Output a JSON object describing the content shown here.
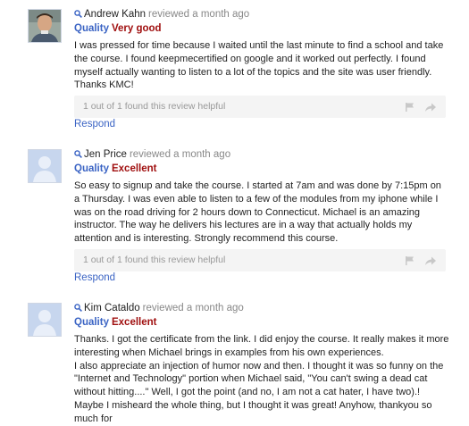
{
  "reviews": [
    {
      "author": "Andrew Kahn",
      "meta": "reviewed a month ago",
      "quality_label": "Quality",
      "rating": "Very good",
      "avatar": "user-photo",
      "body": "I was pressed for time because I waited until the last minute to find a school and take the course. I found keepmecertified on google and it worked out perfectly. I found myself actually wanting to listen to a lot of the topics and the site was user friendly. Thanks KMC!",
      "helpful": "1 out of 1 found this review helpful",
      "respond": "Respond"
    },
    {
      "author": "Jen Price",
      "meta": "reviewed a month ago",
      "quality_label": "Quality",
      "rating": "Excellent",
      "avatar": "default-user-silhouette",
      "body": "So easy to signup and take the course. I started at 7am and was done by 7:15pm on a Thursday. I was even able to listen to a few of the modules from my iphone while I was on the road driving for 2 hours down to Connecticut. Michael is an amazing instructor. The way he delivers his lectures are in a way that actually holds my attention and is interesting. Strongly recommend this course.",
      "helpful": "1 out of 1 found this review helpful",
      "respond": "Respond"
    },
    {
      "author": "Kim Cataldo",
      "meta": "reviewed a month ago",
      "quality_label": "Quality",
      "rating": "Excellent",
      "avatar": "default-user-silhouette",
      "body_paragraphs": [
        "Thanks. I got the certificate from the link. I did enjoy the course. It really makes it more interesting when Michael brings in examples from his own experiences.",
        "I also appreciate an injection of humor now and then. I thought it was so funny on the \"Internet and Technology\" portion when Michael said, \"You can't swing a dead cat without hitting....\" Well, I got the point (and no, I am not a cat hater, I have two).! Maybe I misheard the whole thing, but I thought it was great! Anyhow, thankyou so much for"
      ]
    }
  ],
  "icons": {
    "search": "magnifier-icon",
    "flag": "flag-icon",
    "share": "share-arrow-icon"
  },
  "colors": {
    "link": "#3b64c4",
    "rating": "#a01010",
    "meta": "#888888",
    "helpbar": "#f4f4f4"
  }
}
